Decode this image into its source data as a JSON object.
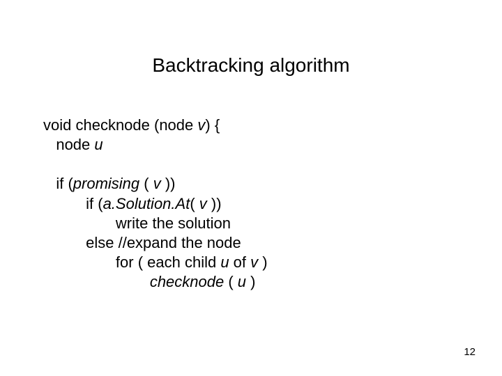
{
  "title": "Backtracking algorithm",
  "code": {
    "l1a": "void checknode (node ",
    "l1b": "v",
    "l1c": ") {",
    "l2a": "   node ",
    "l2b": "u",
    "l3": "",
    "l4a": "   if (",
    "l4b": "promising",
    "l4c": " ( ",
    "l4d": "v",
    "l4e": " ))",
    "l5a": "          if (",
    "l5b": "a.Solution.At",
    "l5c": "( ",
    "l5d": "v",
    "l5e": " ))",
    "l6": "                 write the solution",
    "l7": "          else //expand the node",
    "l8a": "                 for ( each child ",
    "l8b": "u",
    "l8c": " of ",
    "l8d": "v",
    "l8e": " )",
    "l9a": "                         ",
    "l9b": "checknode",
    "l9c": " ( ",
    "l9d": "u",
    "l9e": " )"
  },
  "page_number": "12"
}
